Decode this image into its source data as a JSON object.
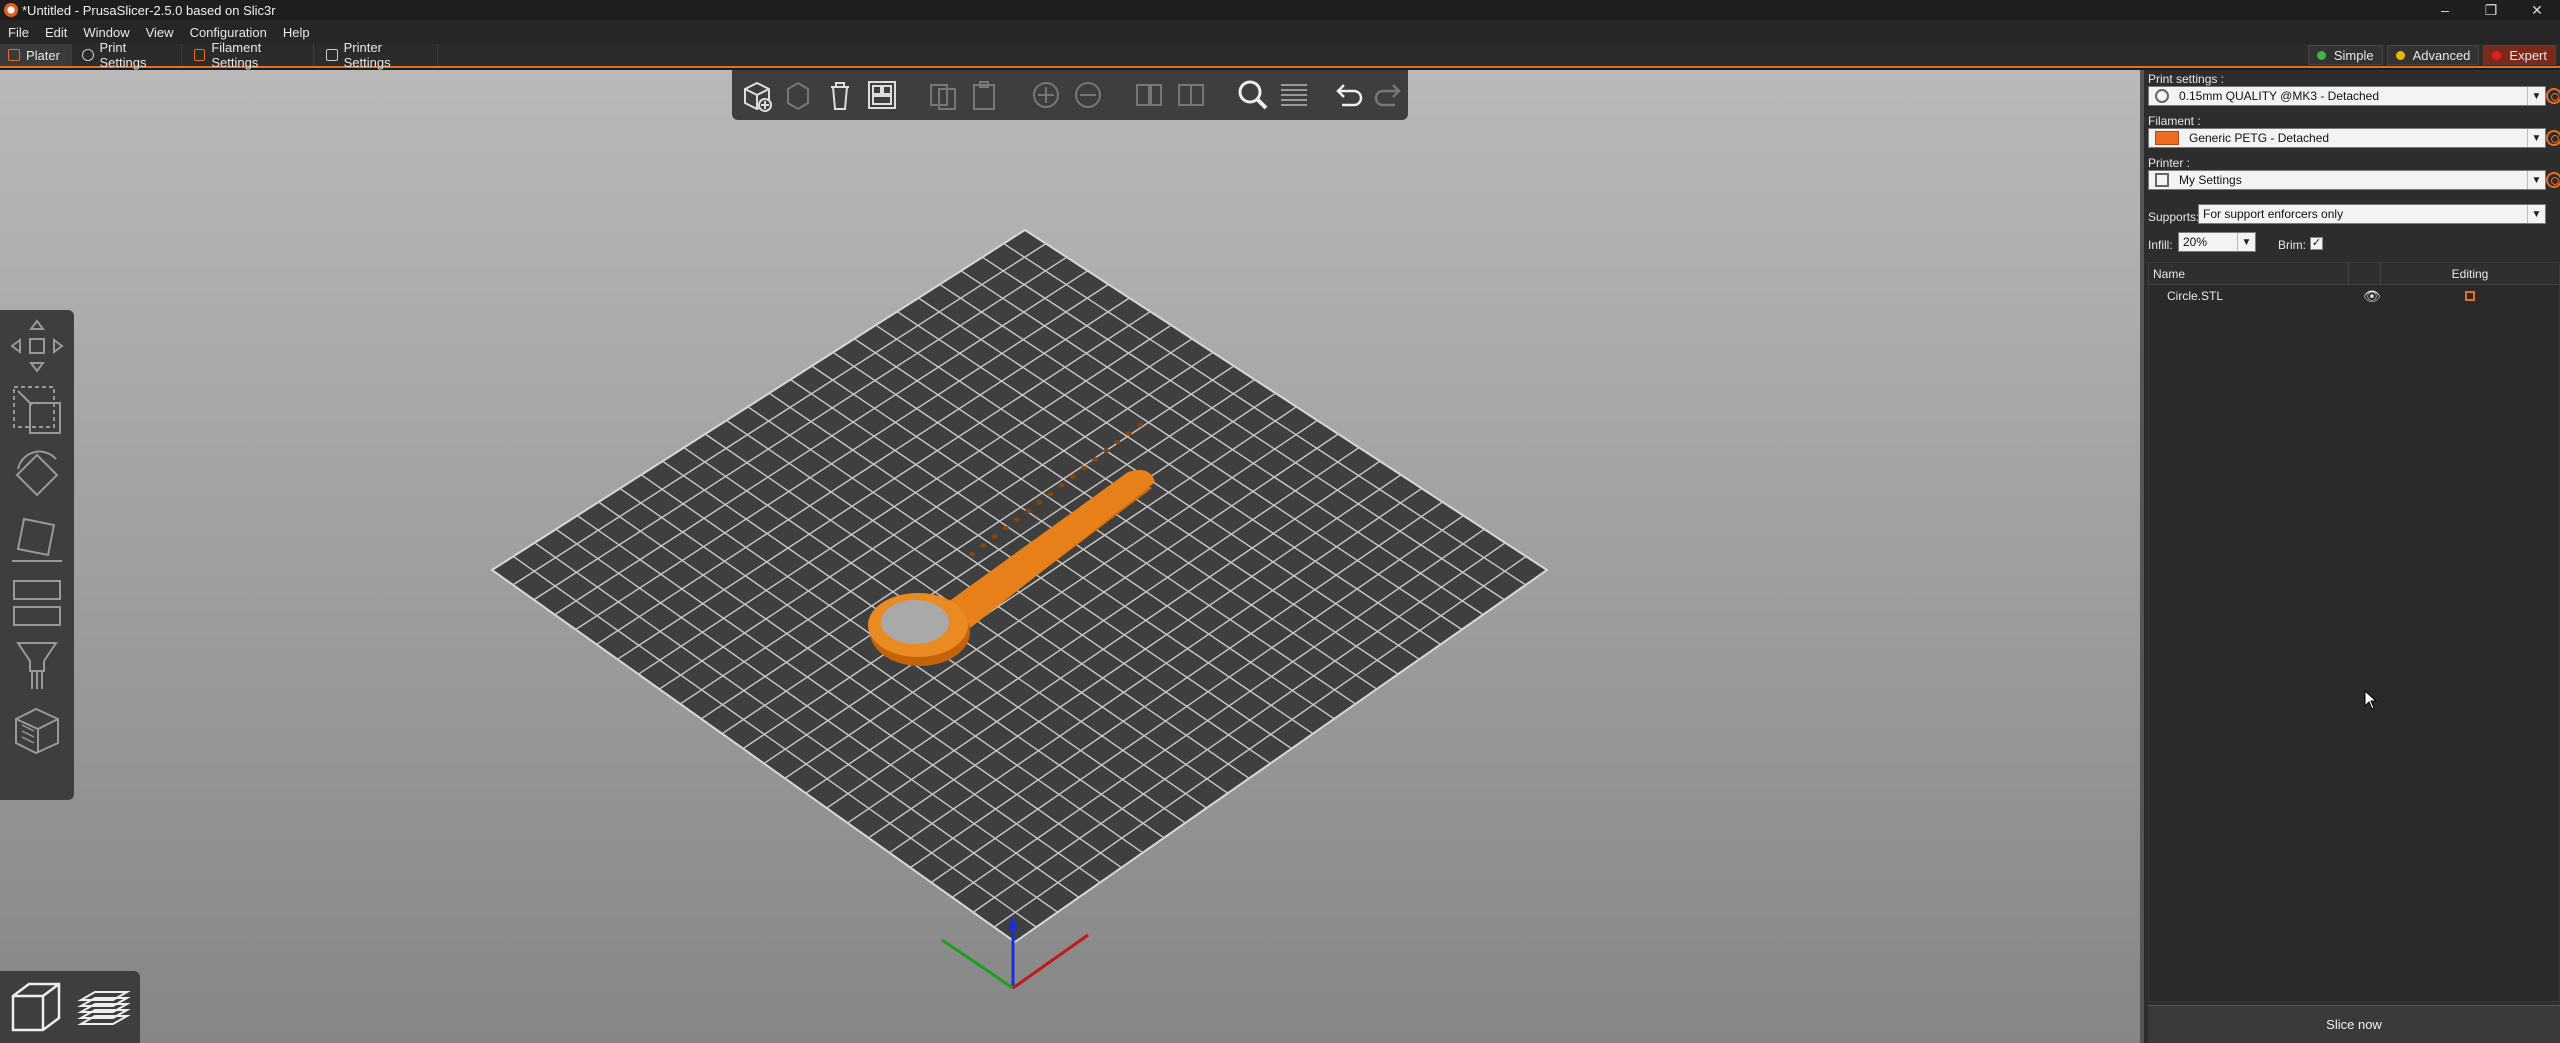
{
  "window": {
    "title": "*Untitled - PrusaSlicer-2.5.0 based on Slic3r",
    "controls": [
      "–",
      "❐",
      "✕"
    ]
  },
  "menu": [
    "File",
    "Edit",
    "Window",
    "View",
    "Configuration",
    "Help"
  ],
  "tabs": [
    {
      "label": "Plater",
      "icon": "plater-icon",
      "active": true
    },
    {
      "label": "Print Settings",
      "icon": "print-settings-icon",
      "active": false
    },
    {
      "label": "Filament Settings",
      "icon": "filament-icon",
      "active": false
    },
    {
      "label": "Printer Settings",
      "icon": "printer-icon",
      "active": false
    }
  ],
  "modes": [
    {
      "label": "Simple",
      "color": "#3fb53f"
    },
    {
      "label": "Advanced",
      "color": "#e8b800"
    },
    {
      "label": "Expert",
      "color": "#e02020",
      "active": true
    }
  ],
  "toolbar_icons": [
    "add-icon",
    "delete-icon",
    "delete-all-icon",
    "arrange-icon",
    "copy-icon",
    "paste-icon",
    "add-instance-icon",
    "remove-instance-icon",
    "split-objects-icon",
    "split-parts-icon",
    "search-icon",
    "layers-editing-icon",
    "undo-icon",
    "redo-icon"
  ],
  "left_tools": [
    "move-icon",
    "scale-icon",
    "rotate-icon",
    "place-on-face-icon",
    "cut-icon",
    "support-paint-icon",
    "seam-paint-icon"
  ],
  "view_buttons": [
    "3d-view-icon",
    "preview-icon"
  ],
  "sidebar": {
    "print_settings_label": "Print settings :",
    "print_settings_value": "0.15mm QUALITY @MK3 - Detached",
    "filament_label": "Filament :",
    "filament_value": "Generic PETG - Detached",
    "filament_color": "#ed6b21",
    "printer_label": "Printer :",
    "printer_value": "My Settings",
    "supports_label": "Supports:",
    "supports_value": "For support enforcers only",
    "infill_label": "Infill:",
    "infill_value": "20%",
    "brim_label": "Brim:",
    "brim_checked": true,
    "columns": {
      "name": "Name",
      "editing": "Editing"
    },
    "objects": [
      {
        "name": "Circle.STL"
      }
    ],
    "slice_button": "Slice now"
  },
  "colors": {
    "accent": "#ed6b21",
    "bed": "#3f3f3f",
    "object": "#e87d10"
  }
}
